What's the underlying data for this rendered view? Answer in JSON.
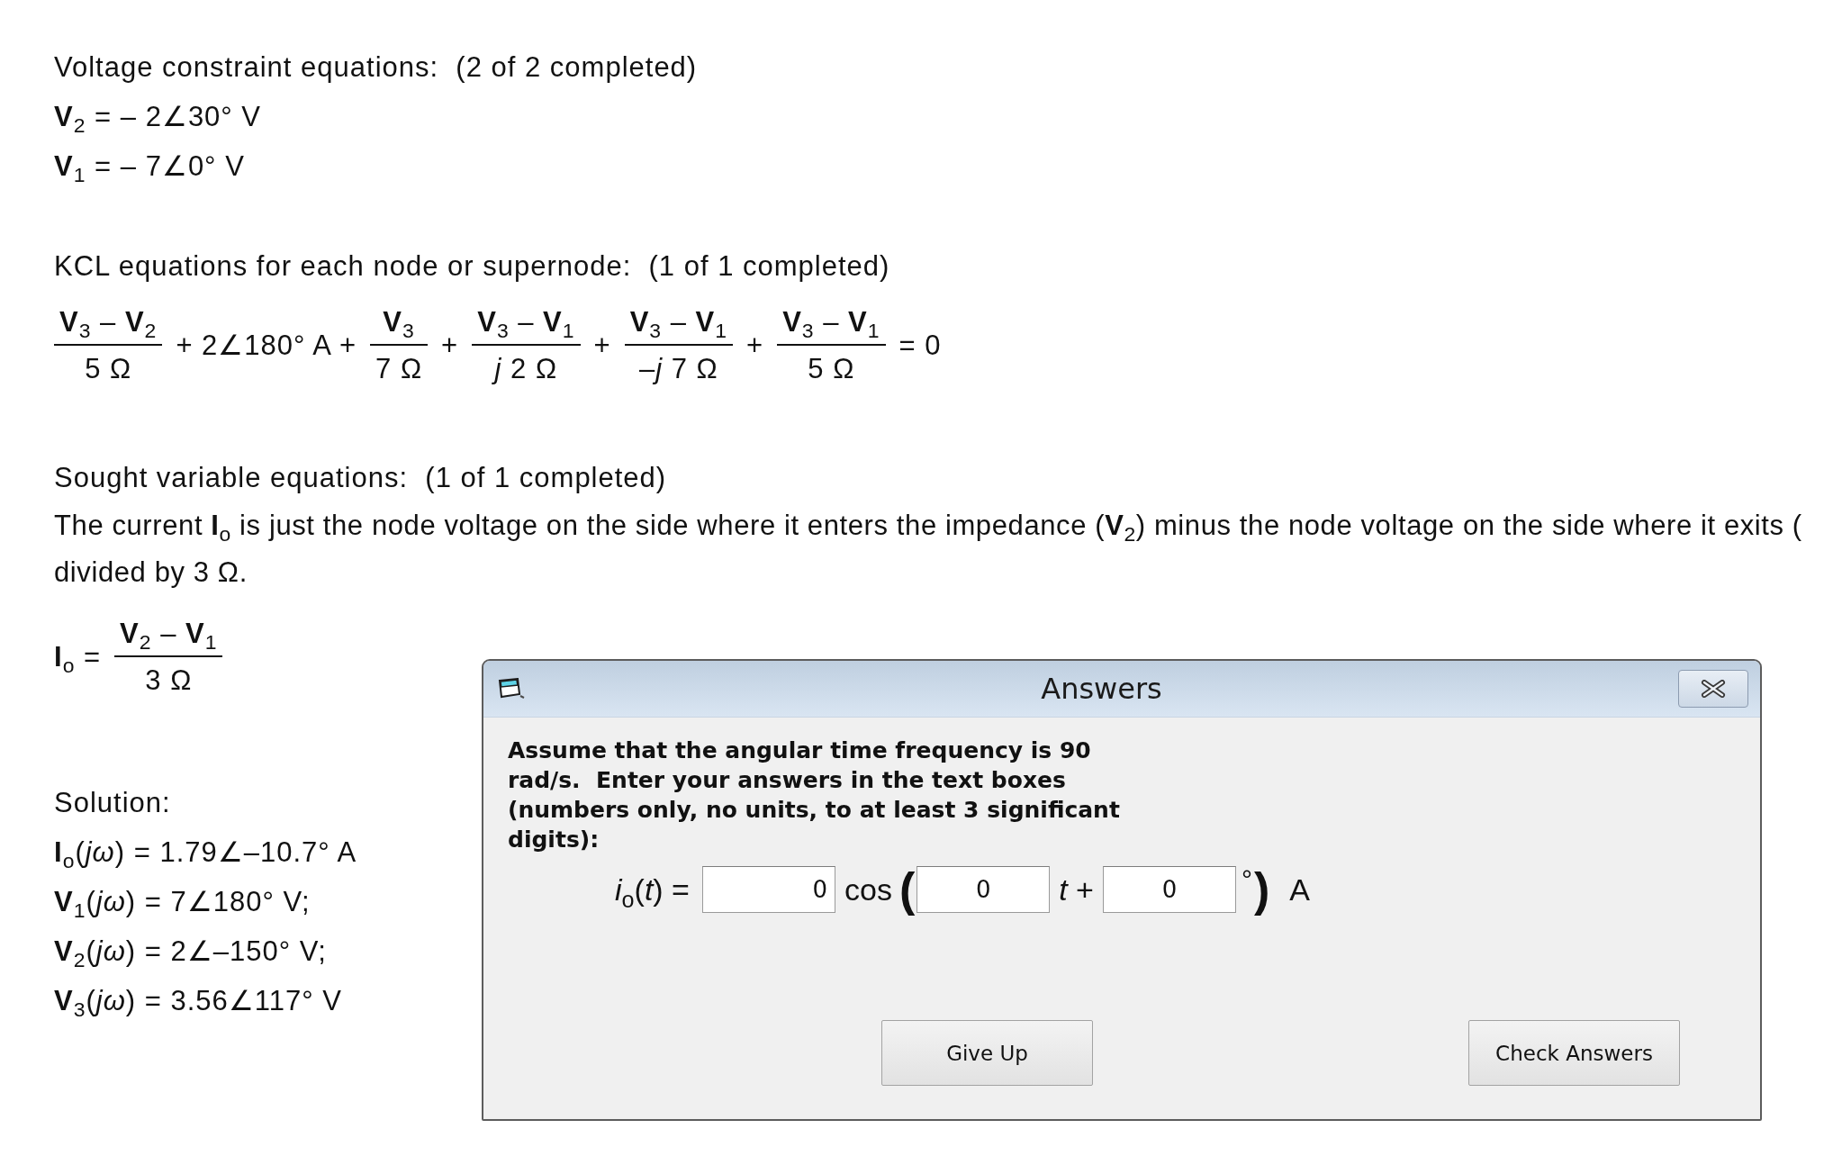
{
  "voltage_constraints": {
    "heading": "Voltage constraint equations:  (2 of 2 completed)",
    "equations": [
      "**V**$_{2}$ = – 2∠30° V",
      "**V**$_{1}$ = – 7∠0° V"
    ]
  },
  "kcl": {
    "heading": "KCL equations for each node or supernode:  (1 of 1 completed)",
    "terms": [
      {
        "kind": "fraction",
        "numerator": "**V**$_{3}$ – **V**$_{2}$",
        "denominator": "5 Ω"
      },
      {
        "kind": "text",
        "text": "+ 2∠180° A +"
      },
      {
        "kind": "fraction",
        "numerator": "**V**$_{3}$",
        "denominator": "7 Ω"
      },
      {
        "kind": "text",
        "text": "+"
      },
      {
        "kind": "fraction",
        "numerator": "**V**$_{3}$ – **V**$_{1}$",
        "denominator": "*j* 2 Ω"
      },
      {
        "kind": "text",
        "text": "+"
      },
      {
        "kind": "fraction",
        "numerator": "**V**$_{3}$ – **V**$_{1}$",
        "denominator": "–*j* 7 Ω"
      },
      {
        "kind": "text",
        "text": "+"
      },
      {
        "kind": "fraction",
        "numerator": "**V**$_{3}$ – **V**$_{1}$",
        "denominator": "5 Ω"
      },
      {
        "kind": "text",
        "text": "= 0"
      }
    ]
  },
  "sought": {
    "heading": "Sought variable equations:  (1 of 1 completed)",
    "explanation_lines": [
      "The current **I**$_{o}$ is just the node voltage on the side where it enters the impedance (**V**$_{2}$) minus the node voltage on the side where it exits (",
      "divided by 3 Ω."
    ],
    "terms": [
      {
        "kind": "text",
        "text": "**I**$_{o}$ ="
      },
      {
        "kind": "fraction",
        "numerator": "**V**$_{2}$ – **V**$_{1}$",
        "denominator": "3 Ω"
      }
    ]
  },
  "solution": {
    "heading": "Solution:",
    "lines": [
      "**I**$_{o}$(*jω*) = 1.79∠–10.7° A",
      "**V**$_{1}$(*jω*) = 7∠180° V;",
      "**V**$_{2}$(*jω*) = 2∠–150° V;",
      "**V**$_{3}$(*jω*) = 3.56∠117° V"
    ]
  },
  "answers_dialog": {
    "title": "Answers",
    "instructions": "Assume that the angular time frequency is 90 rad/s.  Enter your answers in the text boxes (numbers only, no units, to at least 3 significant digits):",
    "answer_row": [
      {
        "kind": "text",
        "text": "*i*$_{o}$(*t*) ="
      },
      {
        "kind": "input",
        "value": "0"
      },
      {
        "kind": "text",
        "text": "cos"
      },
      {
        "kind": "bracket",
        "text": "("
      },
      {
        "kind": "input",
        "value": "0"
      },
      {
        "kind": "text",
        "text": "*t* +"
      },
      {
        "kind": "input",
        "value": "0"
      },
      {
        "kind": "degree",
        "text": "°"
      },
      {
        "kind": "bracket",
        "text": ")"
      },
      {
        "kind": "text",
        "text": "A"
      }
    ],
    "buttons": [
      {
        "label": "Give Up"
      },
      {
        "label": "Check Answers"
      }
    ]
  }
}
